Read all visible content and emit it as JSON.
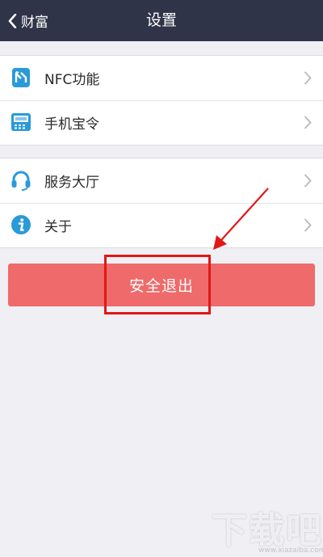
{
  "header": {
    "back_label": "财富",
    "title": "设置"
  },
  "groups": [
    {
      "items": [
        {
          "label": "NFC功能",
          "icon": "nfc-icon"
        },
        {
          "label": "手机宝令",
          "icon": "phone-token-icon"
        }
      ]
    },
    {
      "items": [
        {
          "label": "服务大厅",
          "icon": "headset-icon"
        },
        {
          "label": "关于",
          "icon": "info-icon"
        }
      ]
    }
  ],
  "logout": {
    "label": "安全退出"
  },
  "watermark": {
    "text": "下载吧",
    "sub": "www.xiazaiba.com"
  },
  "colors": {
    "navbar": "#2f3448",
    "background": "#efeff4",
    "icon_blue": "#2a9ad8",
    "logout": "#ef6a6a",
    "annotation": "#e01818"
  }
}
